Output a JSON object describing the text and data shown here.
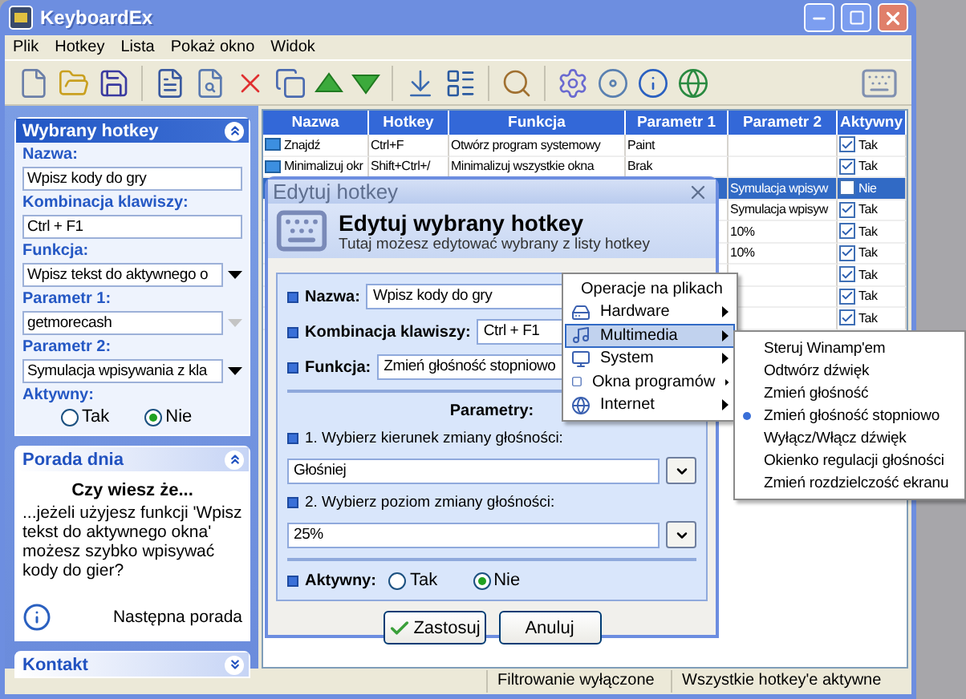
{
  "window": {
    "title": "KeyboardEx"
  },
  "menu": [
    "Plik",
    "Hotkey",
    "Lista",
    "Pokaż okno",
    "Widok"
  ],
  "sidebar": {
    "hotkey_panel": {
      "title": "Wybrany hotkey",
      "expanded": true,
      "fields": [
        {
          "label": "Nazwa:",
          "value": "Wpisz kody do gry",
          "kind": "text"
        },
        {
          "label": "Kombinacja klawiszy:",
          "value": "Ctrl + F1",
          "kind": "text"
        },
        {
          "label": "Funkcja:",
          "value": "Wpisz tekst do aktywnego o",
          "kind": "combo",
          "disabled": false
        },
        {
          "label": "Parametr 1:",
          "value": "getmorecash",
          "kind": "combo",
          "disabled": true
        },
        {
          "label": "Parametr 2:",
          "value": "Symulacja wpisywania z kla",
          "kind": "combo",
          "disabled": false
        }
      ],
      "active": {
        "label": "Aktywny:",
        "options": [
          {
            "label": "Tak",
            "selected": false
          },
          {
            "label": "Nie",
            "selected": true
          }
        ]
      }
    },
    "tip_panel": {
      "title": "Porada dnia",
      "expanded": true,
      "heading": "Czy wiesz że...",
      "text": "...jeżeli użyjesz funkcji 'Wpisz tekst do aktywnego okna' możesz szybko wpisywać kody do gier?",
      "link": "Następna porada"
    },
    "contact_panel": {
      "title": "Kontakt",
      "expanded": false
    }
  },
  "table": {
    "columns": [
      "Nazwa",
      "Hotkey",
      "Funkcja",
      "Parametr 1",
      "Parametr 2",
      "Aktywny"
    ],
    "rows": [
      {
        "selected": false,
        "name": "Znajdź",
        "hotkey": "Ctrl+F",
        "function": "Otwórz program systemowy",
        "param1": "Paint",
        "active": {
          "checked": true,
          "label": "Tak"
        }
      },
      {
        "selected": false,
        "name": "Minimalizuj okr",
        "hotkey": "Shift+Ctrl+/",
        "function": "Minimalizuj wszystkie okna",
        "param1": "Brak",
        "active": {
          "checked": true,
          "label": "Tak"
        }
      },
      {
        "selected": true,
        "param2": "Symulacja wpisyw",
        "active": {
          "checked": false,
          "label": "Nie"
        }
      },
      {
        "selected": false,
        "param2": "Symulacja wpisyw",
        "active": {
          "checked": true,
          "label": "Tak"
        }
      },
      {
        "selected": false,
        "param2": "10%",
        "active": {
          "checked": true,
          "label": "Tak"
        }
      },
      {
        "selected": false,
        "param2": "10%",
        "active": {
          "checked": true,
          "label": "Tak"
        }
      },
      {
        "selected": false,
        "active": {
          "checked": true,
          "label": "Tak"
        }
      },
      {
        "selected": false,
        "active": {
          "checked": true,
          "label": "Tak"
        }
      },
      {
        "selected": false,
        "active": {
          "checked": true,
          "label": "Tak"
        }
      }
    ]
  },
  "dialog": {
    "title": "Edytuj hotkey",
    "heading": "Edytuj wybrany hotkey",
    "subtitle": "Tutaj możesz edytować wybrany z listy hotkey",
    "fields": [
      {
        "label": "Nazwa:",
        "value": "Wpisz kody do gry"
      },
      {
        "label": "Kombinacja klawiszy:",
        "value": "Ctrl + F1"
      },
      {
        "label": "Funkcja:",
        "value": "Zmień głośność stopniowo"
      }
    ],
    "params_title": "Parametry:",
    "params": [
      {
        "label": "1. Wybierz kierunek zmiany głośności:",
        "value": "Głośniej"
      },
      {
        "label": "2. Wybierz poziom zmiany głośności:",
        "value": "25%"
      }
    ],
    "active": {
      "label": "Aktywny:",
      "options": [
        {
          "label": "Tak",
          "selected": false
        },
        {
          "label": "Nie",
          "selected": true
        }
      ]
    },
    "buttons": [
      {
        "label": "Zastosuj",
        "kind": "apply"
      },
      {
        "label": "Anuluj",
        "kind": "cancel"
      }
    ]
  },
  "context_menu": {
    "items": [
      {
        "label": "Operacje na plikach",
        "selected": false
      },
      {
        "label": "Hardware",
        "selected": false
      },
      {
        "label": "Multimedia",
        "selected": true
      },
      {
        "label": "System",
        "selected": false
      },
      {
        "label": "Okna programów",
        "selected": false
      },
      {
        "label": "Internet",
        "selected": false
      }
    ],
    "submenu": {
      "items": [
        {
          "label": "Steruj Winamp'em",
          "selected": false
        },
        {
          "label": "Odtwórz dźwięk",
          "selected": false
        },
        {
          "label": "Zmień głośność",
          "selected": false
        },
        {
          "label": "Zmień głośność stopniowo",
          "selected": true
        },
        {
          "label": "Wyłącz/Włącz dźwięk",
          "selected": false
        },
        {
          "label": "Okienko regulacji głośności",
          "selected": false
        },
        {
          "label": "Zmień rozdzielczość ekranu",
          "selected": false
        }
      ]
    }
  },
  "status_bar": [
    "Filtrowanie wyłączone",
    "Wszystkie hotkey'e aktywne"
  ]
}
